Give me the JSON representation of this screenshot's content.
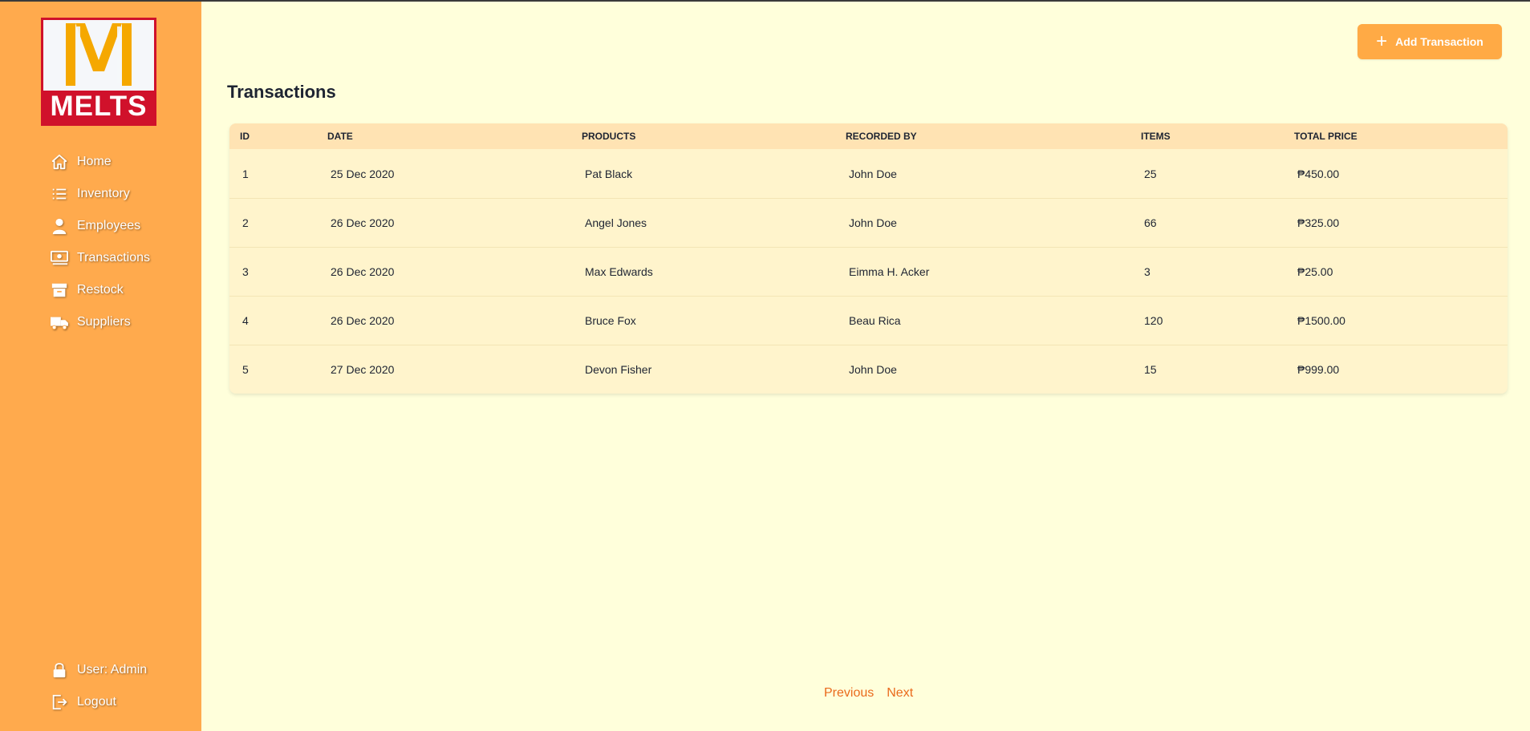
{
  "brand": {
    "name": "MELTS",
    "logo_letter": "M",
    "colors": {
      "sidebar": "#ffaa4d",
      "logo_red": "#d0112b",
      "accent": "#ffaa45",
      "link": "#ea6a1c"
    }
  },
  "sidebar": {
    "items": [
      {
        "label": "Home",
        "icon": "home-icon"
      },
      {
        "label": "Inventory",
        "icon": "list-icon"
      },
      {
        "label": "Employees",
        "icon": "user-icon"
      },
      {
        "label": "Transactions",
        "icon": "money-icon"
      },
      {
        "label": "Restock",
        "icon": "archive-icon"
      },
      {
        "label": "Suppliers",
        "icon": "truck-icon"
      }
    ],
    "bottom": [
      {
        "label": "User: Admin",
        "icon": "lock-icon"
      },
      {
        "label": "Logout",
        "icon": "logout-icon"
      }
    ]
  },
  "header": {
    "add_button_label": "Add Transaction",
    "page_title": "Transactions"
  },
  "table": {
    "columns": [
      "ID",
      "DATE",
      "PRODUCTS",
      "RECORDED BY",
      "ITEMS",
      "TOTAL PRICE"
    ],
    "rows": [
      [
        "1",
        "25 Dec 2020",
        "Pat Black",
        "John Doe",
        "25",
        "₱450.00"
      ],
      [
        "2",
        "26 Dec 2020",
        "Angel Jones",
        "John Doe",
        "66",
        "₱325.00"
      ],
      [
        "3",
        "26 Dec 2020",
        "Max Edwards",
        "Eimma H. Acker",
        "3",
        "₱25.00"
      ],
      [
        "4",
        "26 Dec 2020",
        "Bruce Fox",
        "Beau Rica",
        "120",
        "₱1500.00"
      ],
      [
        "5",
        "27 Dec 2020",
        "Devon Fisher",
        "John Doe",
        "15",
        "₱999.00"
      ]
    ]
  },
  "pagination": {
    "previous": "Previous",
    "next": "Next"
  }
}
